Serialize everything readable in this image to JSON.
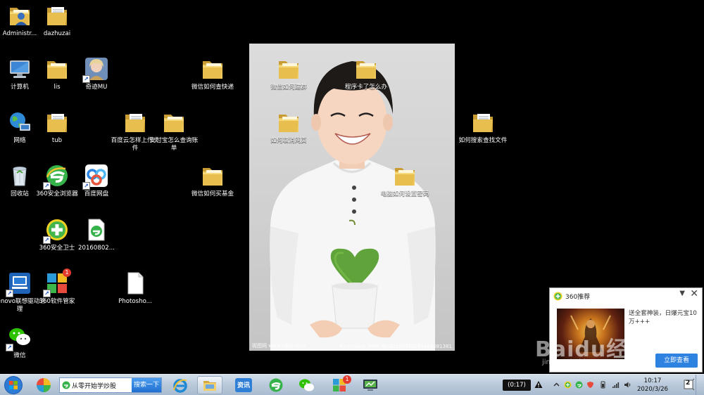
{
  "desktop": {
    "icons": [
      {
        "label": "Administr..."
      },
      {
        "label": "dazhuzai"
      },
      {
        "label": "计算机"
      },
      {
        "label": "lis"
      },
      {
        "label": "奇迹MU"
      },
      {
        "label": "微信如何查快递"
      },
      {
        "label": "程序卡了怎么办"
      },
      {
        "label": "微信如何建群"
      },
      {
        "label": "网络"
      },
      {
        "label": "tub"
      },
      {
        "label": "百度云怎样上传文件"
      },
      {
        "label": "支付宝怎么查询账单"
      },
      {
        "label": "如何取消网页"
      },
      {
        "label": "如何搜索查找文件"
      },
      {
        "label": "回收站"
      },
      {
        "label": "360安全浏览器"
      },
      {
        "label": "百度网盘"
      },
      {
        "label": "微信如何买基金"
      },
      {
        "label": "电脑如何设置密码"
      },
      {
        "label": "360安全卫士"
      },
      {
        "label": "20160802..."
      },
      {
        "label": "Lenovo联想驱动管理"
      },
      {
        "label": "360软件管家"
      },
      {
        "label": "Photosho..."
      },
      {
        "label": "微信"
      }
    ],
    "badge_360soft": "1",
    "wallpaper": {
      "watermark_left": "昵图网 www.nipic.com",
      "watermark_right": "By:Yvonne_HMX No:20150720185484081381"
    }
  },
  "popup360": {
    "title": "360推荐",
    "menu_glyph": "▼",
    "close_glyph": "✕",
    "ad_text": "送全套神装，日爆元宝10万+++",
    "button_label": "立即查看"
  },
  "baidu_watermark": {
    "main": "Baidu经验",
    "sub": "jingyan.baidu.com"
  },
  "taskbar": {
    "search_value": "从零开始学炒股",
    "search_button": "搜索一下",
    "app_zixun_label": "资讯",
    "badge_app": "1",
    "timer": "(0:17)",
    "clock_time": "10:17",
    "clock_date": "2020/3/26",
    "notification_count": "2"
  },
  "colors": {
    "folder": "#e8c25a",
    "taskbar_top": "#d3deea",
    "popup_button": "#2f83e0",
    "search_button": "#1f6fd1"
  }
}
